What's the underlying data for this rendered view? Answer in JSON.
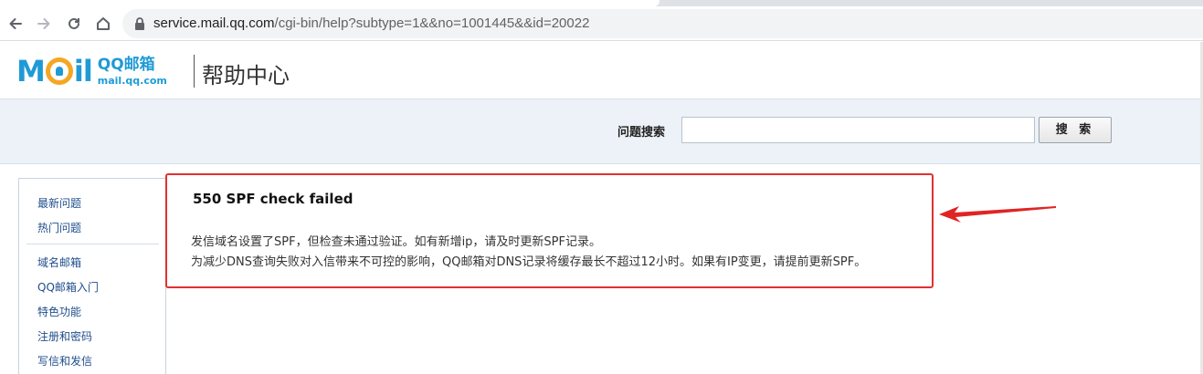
{
  "browser": {
    "url_host": "service.mail.qq.com",
    "url_path": "/cgi-bin/help?subtype=1&&no=1001445&&id=20022",
    "icons": [
      "back-icon",
      "forward-icon",
      "reload-icon",
      "home-icon",
      "lock-icon"
    ]
  },
  "header": {
    "logo_word_left": "M",
    "logo_word_right": "il",
    "logo_cn": "QQ邮箱",
    "logo_en": "mail.qq.com",
    "help_title": "帮助中心",
    "brand_color": "#1f9ad6"
  },
  "search": {
    "label": "问题搜索",
    "input_value": "",
    "button_label": "搜 索"
  },
  "sidebar": {
    "items": [
      {
        "label": "最新问题"
      },
      {
        "label": "热门问题"
      },
      {
        "label": "域名邮箱"
      },
      {
        "label": "QQ邮箱入门"
      },
      {
        "label": "特色功能"
      },
      {
        "label": "注册和密码"
      },
      {
        "label": "写信和发信"
      }
    ]
  },
  "content": {
    "title": "550 SPF check failed",
    "lines": [
      "发信域名设置了SPF，但检查未通过验证。如有新增ip，请及时更新SPF记录。",
      "为减少DNS查询失败对入信带来不可控的影响，QQ邮箱对DNS记录将缓存最长不超过12小时。如果有IP变更，请提前更新SPF。"
    ],
    "highlight_color": "#e03131"
  }
}
